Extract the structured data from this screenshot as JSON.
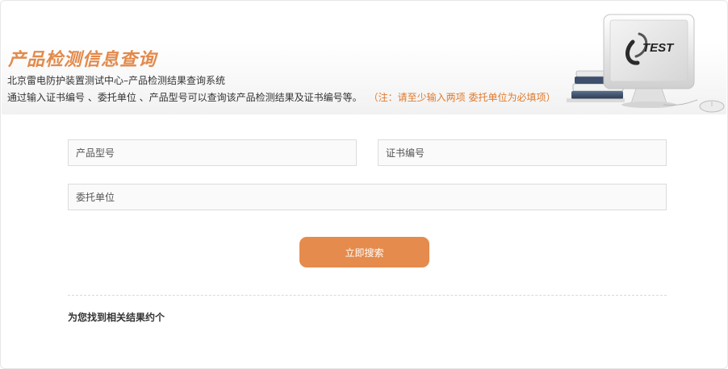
{
  "colors": {
    "accent": "#e38a4b",
    "note": "#e07a2e",
    "button": "#e58b4d"
  },
  "banner": {
    "title": "产品检测信息查询",
    "subtitle": "北京雷电防护装置测试中心–产品检测结果查询系统",
    "description": "通过输入证书编号 、委托单位 、产品型号可以查询该产品检测结果及证书编号等。",
    "note": "（注：请至少输入两项 委托单位为必填项）",
    "logo_text": "TEST"
  },
  "form": {
    "product_model_placeholder": "产品型号",
    "certificate_no_placeholder": "证书编号",
    "client_unit_placeholder": "委托单位",
    "search_button": "立即搜索"
  },
  "results": {
    "summary": "为您找到相关结果约个"
  }
}
